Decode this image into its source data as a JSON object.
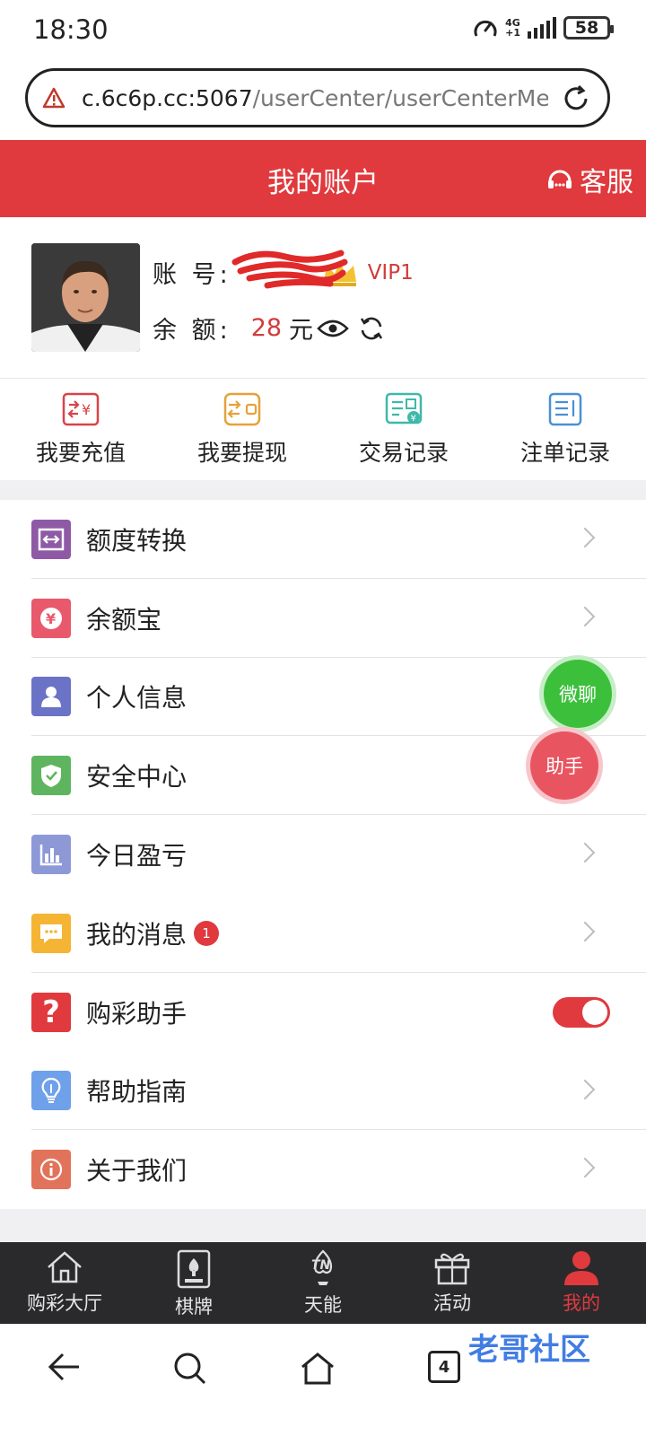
{
  "status_bar": {
    "time": "18:30",
    "network_top": "4G",
    "network_bottom": "+1",
    "battery": "58"
  },
  "url_bar": {
    "host": "c.6c6p.cc:5067",
    "path": "/userCenter/userCenterMen"
  },
  "header": {
    "title": "我的账户",
    "customer_service": "客服",
    "color": "#e03a3e"
  },
  "profile": {
    "account_label": "账 号:",
    "vip": "VIP1",
    "balance_label": "余 额:",
    "balance_value": "28",
    "balance_unit": "元"
  },
  "quick_actions": [
    {
      "label": "我要充值",
      "icon": "recharge-icon"
    },
    {
      "label": "我要提现",
      "icon": "withdraw-icon"
    },
    {
      "label": "交易记录",
      "icon": "transaction-record-icon"
    },
    {
      "label": "注单记录",
      "icon": "bet-record-icon"
    }
  ],
  "menu": [
    {
      "label": "额度转换",
      "icon": "transfer-icon",
      "color": "#8e5aa6"
    },
    {
      "label": "余额宝",
      "icon": "yuan-icon",
      "color": "#e8596b"
    },
    {
      "label": "个人信息",
      "icon": "person-icon",
      "color": "#6b73c6"
    },
    {
      "label": "安全中心",
      "icon": "shield-icon",
      "color": "#5fb55f"
    },
    {
      "label": "今日盈亏",
      "icon": "bar-chart-icon",
      "color": "#8d99d6"
    },
    {
      "label": "我的消息",
      "icon": "message-icon",
      "color": "#f5b433",
      "badge": "1"
    },
    {
      "label": "购彩助手",
      "icon": "question-icon",
      "color": "#e03a3e",
      "toggle": true
    },
    {
      "label": "帮助指南",
      "icon": "lightbulb-icon",
      "color": "#6fa0ea"
    },
    {
      "label": "关于我们",
      "icon": "info-icon",
      "color": "#e2735b"
    }
  ],
  "floating": {
    "chat": "微聊",
    "helper": "助手"
  },
  "tabs": [
    {
      "label": "购彩大厅",
      "icon": "home-icon"
    },
    {
      "label": "棋牌",
      "icon": "cards-icon"
    },
    {
      "label": "天能",
      "icon": "tn-icon"
    },
    {
      "label": "活动",
      "icon": "gift-icon"
    },
    {
      "label": "我的",
      "icon": "user-icon",
      "active": true
    }
  ],
  "system_nav": {
    "tabs_count": "4"
  },
  "watermark": "老哥社区"
}
